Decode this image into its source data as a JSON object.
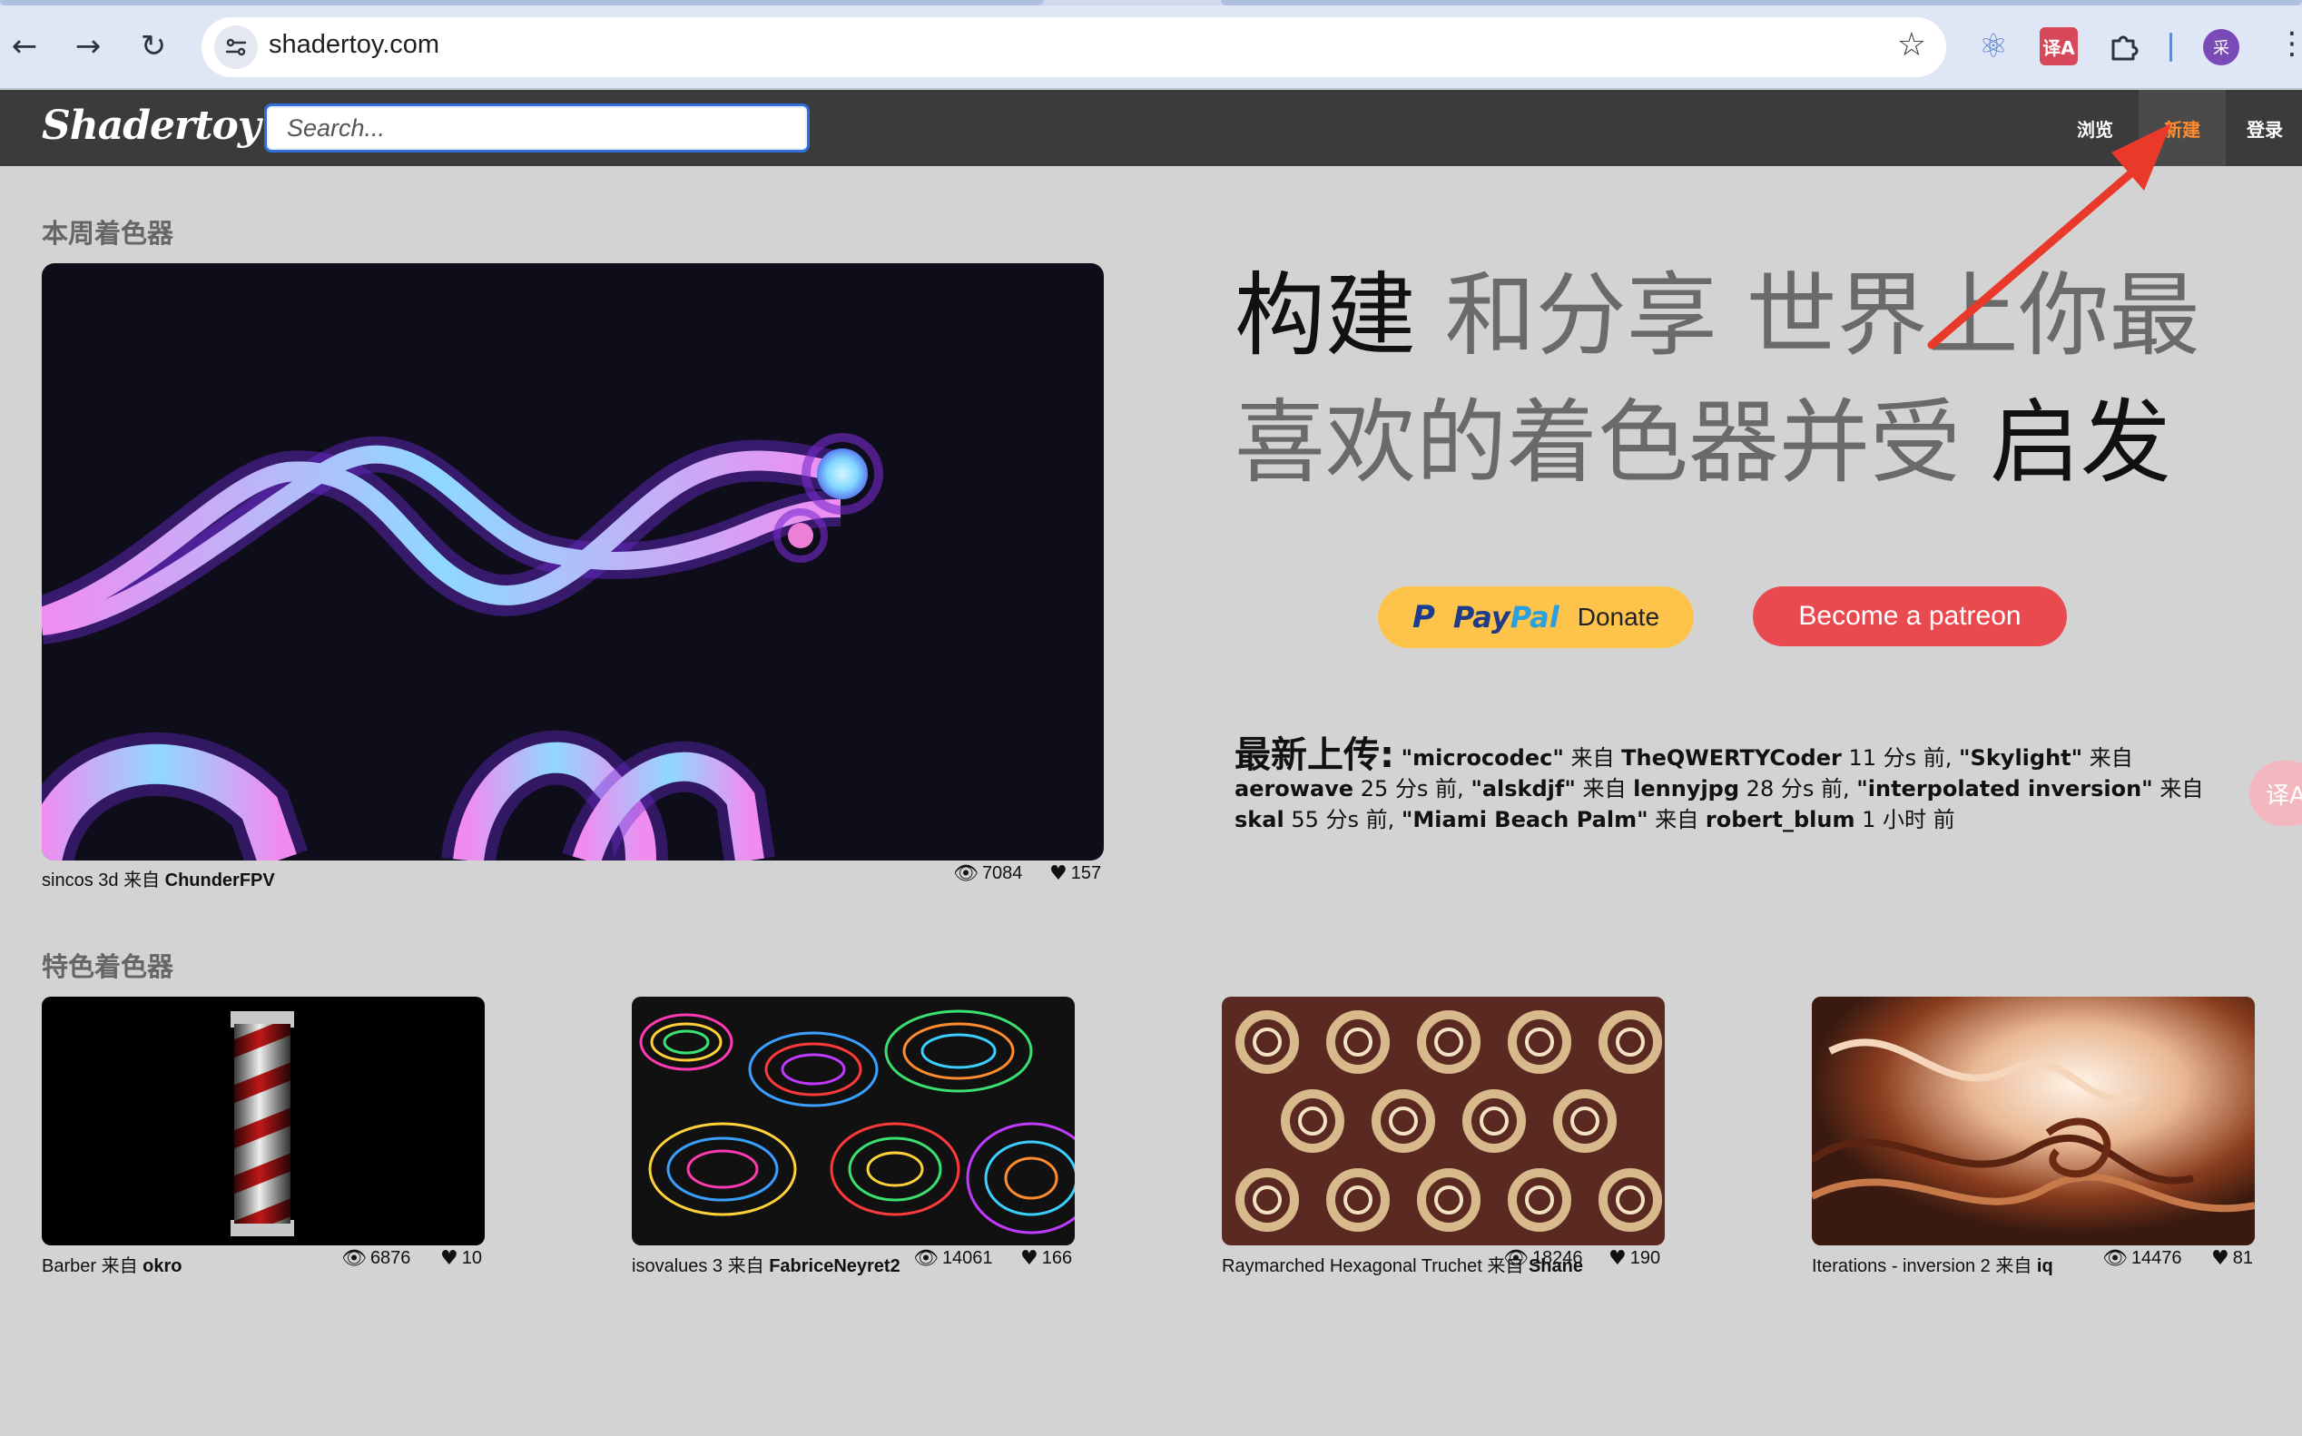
{
  "browser": {
    "url": "shadertoy.com",
    "back_icon": "←",
    "forward_icon": "→",
    "reload_icon": "↻",
    "star_icon": "☆",
    "react_icon": "⚛",
    "translate_icon": "译A",
    "extensions_icon": "⧉",
    "profile_initial": "采",
    "menu_icon": "⋮"
  },
  "header": {
    "logo": "Shadertoy",
    "search_placeholder": "Search...",
    "nav": {
      "browse": "浏览",
      "new": "新建",
      "login": "登录"
    }
  },
  "weekly": {
    "section_title": "本周着色器",
    "name": "sincos 3d",
    "from": "来自",
    "author": "ChunderFPV",
    "views": "7084",
    "likes": "157"
  },
  "slogan": {
    "part1": "构建",
    "part2": "和分享",
    "part3": "世界上你最喜欢的着色器并受",
    "part4": "启发"
  },
  "donate": {
    "paypal_p": "P",
    "paypal_pay": "Pay",
    "paypal_pal": "Pal",
    "paypal_donate": "Donate",
    "patreon": "Become a patreon"
  },
  "latest": {
    "label": "最新上传:",
    "items": [
      {
        "name": "\"microcodec\"",
        "from": "来自",
        "author": "TheQWERTYCoder",
        "time": "11 分s 前,"
      },
      {
        "name": "\"Skylight\"",
        "from": "来自",
        "author": "aerowave",
        "time": "25 分s 前,"
      },
      {
        "name": "\"alskdjf\"",
        "from": "来自",
        "author": "lennyjpg",
        "time": "28 分s 前,"
      },
      {
        "name": "\"interpolated inversion\"",
        "from": "来自",
        "author": "skal",
        "time": "55 分s 前,"
      },
      {
        "name": "\"Miami Beach Palm\"",
        "from": "来自",
        "author": "robert_blum",
        "time": "1 小时 前"
      }
    ]
  },
  "featured": {
    "section_title": "特色着色器",
    "items": [
      {
        "name": "Barber",
        "from": "来自",
        "author": "okro",
        "views": "6876",
        "likes": "10"
      },
      {
        "name": "isovalues 3",
        "from": "来自",
        "author": "FabriceNeyret2",
        "views": "14061",
        "likes": "166"
      },
      {
        "name": "Raymarched Hexagonal Truchet",
        "from": "来自",
        "author": "Shane",
        "views": "18246",
        "likes": "190"
      },
      {
        "name": "Iterations - inversion 2",
        "from": "来自",
        "author": "iq",
        "views": "14476",
        "likes": "81"
      }
    ]
  },
  "colors": {
    "header_bg": "#3b3b3b",
    "active_nav": "#ff8c2e",
    "page_bg": "#d3d3d3",
    "patreon": "#e84a4f",
    "paypal": "#fec34a",
    "arrow": "#e8392b"
  },
  "icons": {
    "eye": "👁",
    "heart": "♥"
  }
}
